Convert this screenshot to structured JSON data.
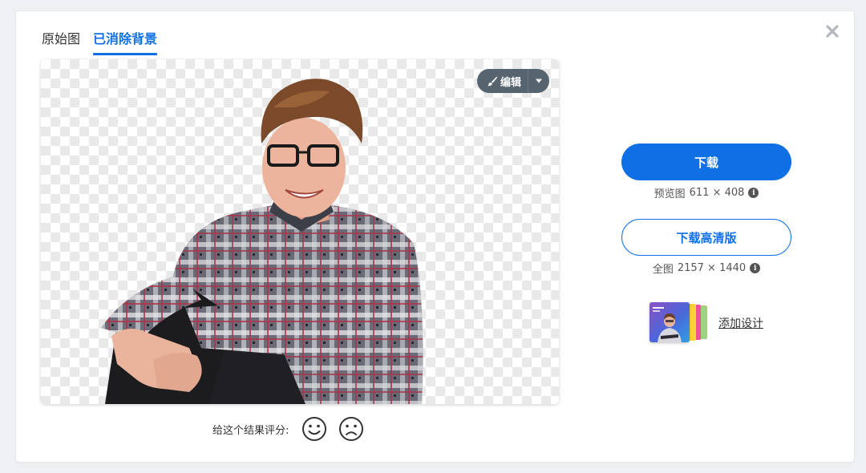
{
  "tabs": {
    "original": "原始图",
    "removed": "已消除背景"
  },
  "edit": {
    "label": "编辑"
  },
  "download": {
    "label": "下载",
    "note_prefix": "预览图",
    "note_size": "611 × 408"
  },
  "download_hd": {
    "label": "下载高清版",
    "note_prefix": "全图",
    "note_size": "2157 × 1440"
  },
  "design": {
    "label": "添加设计"
  },
  "rating": {
    "label": "给这个结果评分:"
  },
  "icons": [
    "close-icon",
    "brush-icon",
    "caret-down-icon",
    "info-icon",
    "smile-icon",
    "frown-icon"
  ],
  "colors": {
    "accent": "#0f70e6",
    "edit_button": "#56646f",
    "checker": "#e9e9e9"
  }
}
